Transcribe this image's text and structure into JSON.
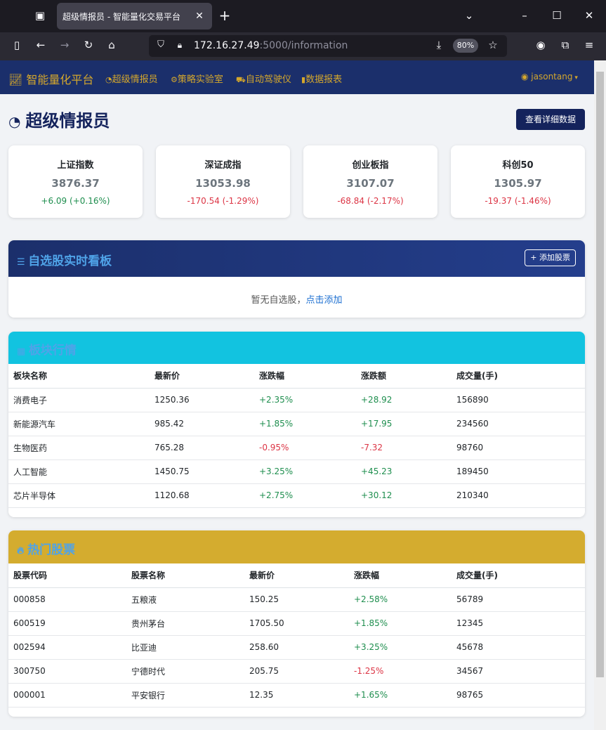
{
  "browser": {
    "tab_title": "超级情报员 - 智能量化交易平台",
    "url_host": "172.16.27.49",
    "url_path": ":5000/information",
    "zoom": "80%"
  },
  "app": {
    "brand": "智能量化平台",
    "nav": [
      "超级情报员",
      "策略实验室",
      "自动驾驶仪",
      "数据报表"
    ],
    "user": "jasontang"
  },
  "page": {
    "title": "超级情报员",
    "detail_button": "查看详细数据"
  },
  "indices": [
    {
      "name": "上证指数",
      "price": "3876.37",
      "change": "+6.09 (+0.16%)",
      "dir": "up"
    },
    {
      "name": "深证成指",
      "price": "13053.98",
      "change": "-170.54 (-1.29%)",
      "dir": "down"
    },
    {
      "name": "创业板指",
      "price": "3107.07",
      "change": "-68.84 (-2.17%)",
      "dir": "down"
    },
    {
      "name": "科创50",
      "price": "1305.97",
      "change": "-19.37 (-1.46%)",
      "dir": "down"
    }
  ],
  "watchlist": {
    "title": "自选股实时看板",
    "add_button": "+ 添加股票",
    "empty_text": "暂无自选股，",
    "empty_link": "点击添加"
  },
  "sectors": {
    "title": "板块行情",
    "headers": [
      "板块名称",
      "最新价",
      "涨跌幅",
      "涨跌额",
      "成交量(手)"
    ],
    "rows": [
      [
        "消费电子",
        "1250.36",
        "+2.35%",
        "+28.92",
        "156890"
      ],
      [
        "新能源汽车",
        "985.42",
        "+1.85%",
        "+17.95",
        "234560"
      ],
      [
        "生物医药",
        "765.28",
        "-0.95%",
        "-7.32",
        "98760"
      ],
      [
        "人工智能",
        "1450.75",
        "+3.25%",
        "+45.23",
        "189450"
      ],
      [
        "芯片半导体",
        "1120.68",
        "+2.75%",
        "+30.12",
        "210340"
      ]
    ]
  },
  "hot": {
    "title": "热门股票",
    "headers": [
      "股票代码",
      "股票名称",
      "最新价",
      "涨跌幅",
      "成交量(手)"
    ],
    "rows": [
      [
        "000858",
        "五粮液",
        "150.25",
        "+2.58%",
        "56789"
      ],
      [
        "600519",
        "贵州茅台",
        "1705.50",
        "+1.85%",
        "12345"
      ],
      [
        "002594",
        "比亚迪",
        "258.60",
        "+3.25%",
        "45678"
      ],
      [
        "300750",
        "宁德时代",
        "205.75",
        "-1.25%",
        "34567"
      ],
      [
        "000001",
        "平安银行",
        "12.35",
        "+1.65%",
        "98765"
      ]
    ]
  },
  "colors": {
    "up": "#1e8e4e",
    "down": "#dc3545",
    "navy": "#14235c",
    "gold": "#d4a72c"
  }
}
